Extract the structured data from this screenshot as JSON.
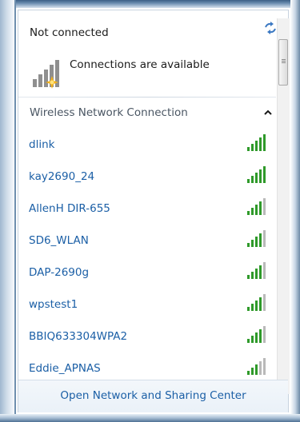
{
  "status": {
    "title": "Not connected",
    "connections_text": "Connections are available",
    "refresh_icon": "refresh-icon",
    "connection_icon": "signal-bars-with-star-icon"
  },
  "section": {
    "title": "Wireless Network Connection",
    "toggle_icon": "chevron-up-icon"
  },
  "networks": [
    {
      "name": "dlink",
      "signal_bars": 5
    },
    {
      "name": "kay2690_24",
      "signal_bars": 5
    },
    {
      "name": "AllenH DIR-655",
      "signal_bars": 4
    },
    {
      "name": "SD6_WLAN",
      "signal_bars": 4
    },
    {
      "name": "DAP-2690g",
      "signal_bars": 4
    },
    {
      "name": "wpstest1",
      "signal_bars": 4
    },
    {
      "name": "BBIQ633304WPA2",
      "signal_bars": 4
    },
    {
      "name": "Eddie_APNAS",
      "signal_bars": 3
    }
  ],
  "footer": {
    "link": "Open Network and Sharing Center"
  },
  "colors": {
    "link": "#1b5fa6",
    "signal_active": "#2f9a2a",
    "signal_inactive": "#b9b9b9"
  }
}
